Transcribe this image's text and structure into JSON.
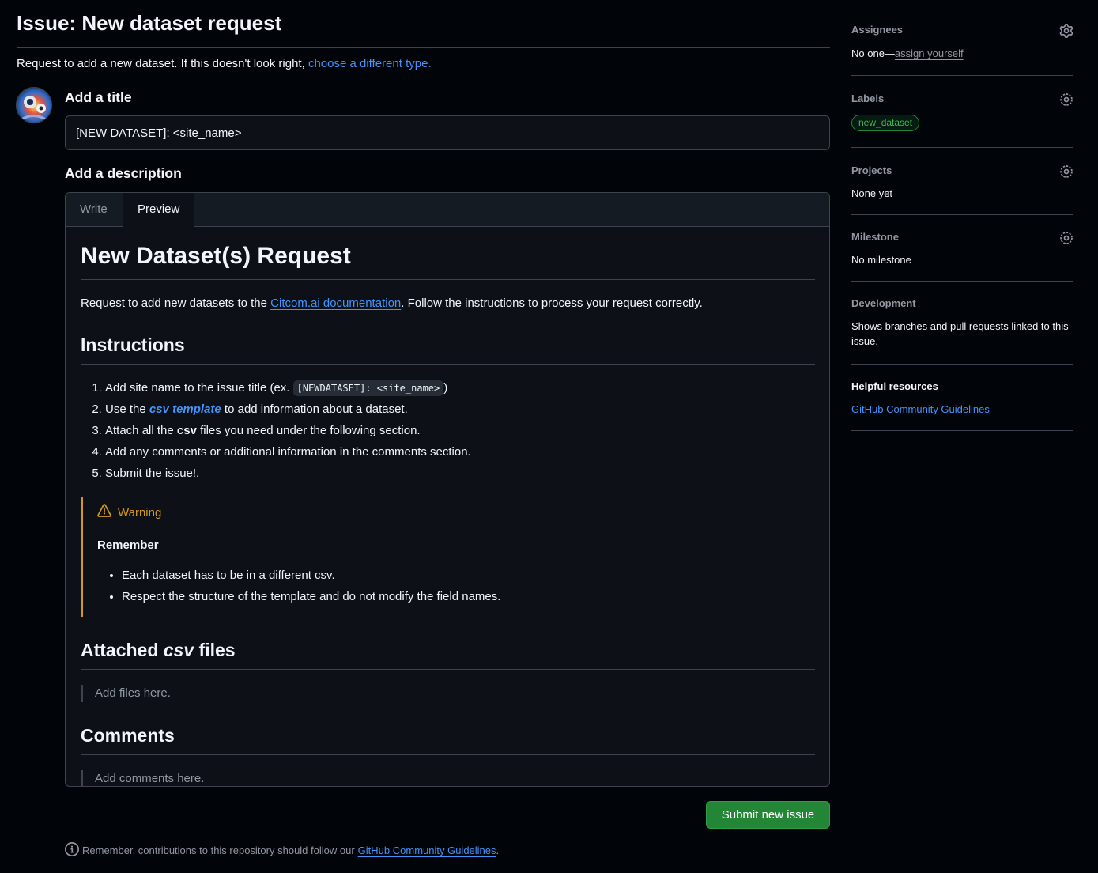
{
  "header": {
    "title": "Issue: New dataset request",
    "subtitle_text": "Request to add a new dataset. If this doesn't look right,",
    "subtitle_link": "choose a different type."
  },
  "form": {
    "title_label": "Add a title",
    "title_value": "[NEW DATASET]: <site_name>",
    "description_label": "Add a description",
    "tabs": [
      "Write",
      "Preview"
    ],
    "active_tab": "Preview"
  },
  "preview": {
    "h1": "New Dataset(s) Request",
    "intro_before": "Request to add new datasets to the ",
    "intro_link": "Citcom.ai documentation",
    "intro_after": ". Follow the instructions to process your request correctly.",
    "instructions_heading": "Instructions",
    "step1_before": "Add site name to the issue title (ex. ",
    "step1_code": "[NEWDATASET]: <site_name>",
    "step1_after": ")",
    "step2_before": "Use the ",
    "step2_link": "csv template",
    "step2_after": " to add information about a dataset.",
    "step3_before": "Attach all the ",
    "step3_bold": "csv",
    "step3_after": " files you need under the following section.",
    "step4": "Add any comments or additional information in the comments section.",
    "step5": "Submit the issue!.",
    "warning_title": "Warning",
    "warning_strong": "Remember",
    "warning_items": [
      "Each dataset has to be in a different csv.",
      "Respect the structure of the template and do not modify the field names."
    ],
    "attached_before": "Attached ",
    "attached_em": "csv",
    "attached_after": " files",
    "attached_quote": "Add files here.",
    "comments_heading": "Comments",
    "comments_quote": "Add comments here."
  },
  "actions": {
    "submit_label": "Submit new issue"
  },
  "footer": {
    "text": "Remember, contributions to this repository should follow our",
    "link": "GitHub Community Guidelines",
    "end": "."
  },
  "sidebar": {
    "assignees": {
      "heading": "Assignees",
      "text": "No one—",
      "link": "assign yourself"
    },
    "labels": {
      "heading": "Labels",
      "label": "new_dataset",
      "label_color": "#3fb950"
    },
    "projects": {
      "heading": "Projects",
      "text": "None yet"
    },
    "milestone": {
      "heading": "Milestone",
      "text": "No milestone"
    },
    "development": {
      "heading": "Development",
      "text": "Shows branches and pull requests linked to this issue."
    },
    "resources": {
      "heading": "Helpful resources",
      "link": "GitHub Community Guidelines"
    }
  },
  "colors": {
    "background": "#010409",
    "accent_link": "#4493f8",
    "submit_green": "#238636",
    "warning": "#d29922"
  },
  "icons": [
    "gear-icon",
    "warning-icon",
    "info-icon",
    "avatar"
  ]
}
